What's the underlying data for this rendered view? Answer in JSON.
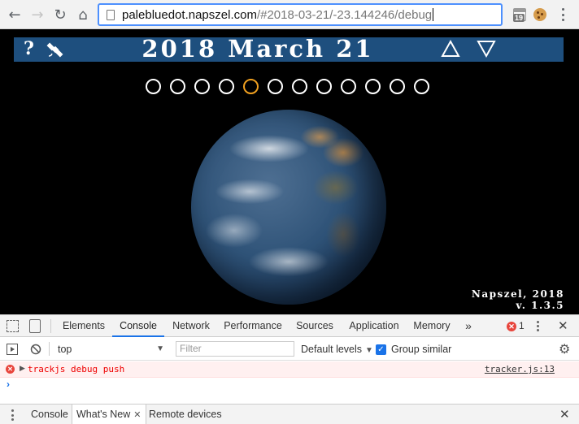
{
  "browser": {
    "url_host": "palebluedot.napszel.com",
    "url_path": "/#2018-03-21/-23.144246/debug",
    "calendar_badge": "19",
    "icons": [
      "back-arrow-icon",
      "forward-arrow-icon",
      "reload-icon",
      "home-icon",
      "calendar-extension-icon",
      "cookie-extension-icon",
      "chrome-menu-icon"
    ]
  },
  "page": {
    "help_label": "?",
    "date_title": "2018 March 21",
    "timeline_dot_count": 12,
    "active_dot_index": 4,
    "active_dot_color": "#f0a020",
    "header_bg_color": "#1e4f7e",
    "credit_line1": "Napszel, 2018",
    "credit_line2": "v. 1.3.5"
  },
  "devtools": {
    "tabs": [
      "Elements",
      "Console",
      "Network",
      "Performance",
      "Sources",
      "Application",
      "Memory"
    ],
    "active_tab": "Console",
    "more_tabs_label": "»",
    "error_count": "1",
    "context_value": "top",
    "filter_placeholder": "Filter",
    "levels_label": "Default levels",
    "group_similar_label": "Group similar",
    "console_entries": [
      {
        "level": "error",
        "message": "trackjs debug push",
        "source": "tracker.js:13"
      }
    ],
    "prompt_symbol": "›",
    "drawer_tabs": [
      "Console",
      "What's New",
      "Remote devices"
    ],
    "drawer_active": "What's New"
  }
}
